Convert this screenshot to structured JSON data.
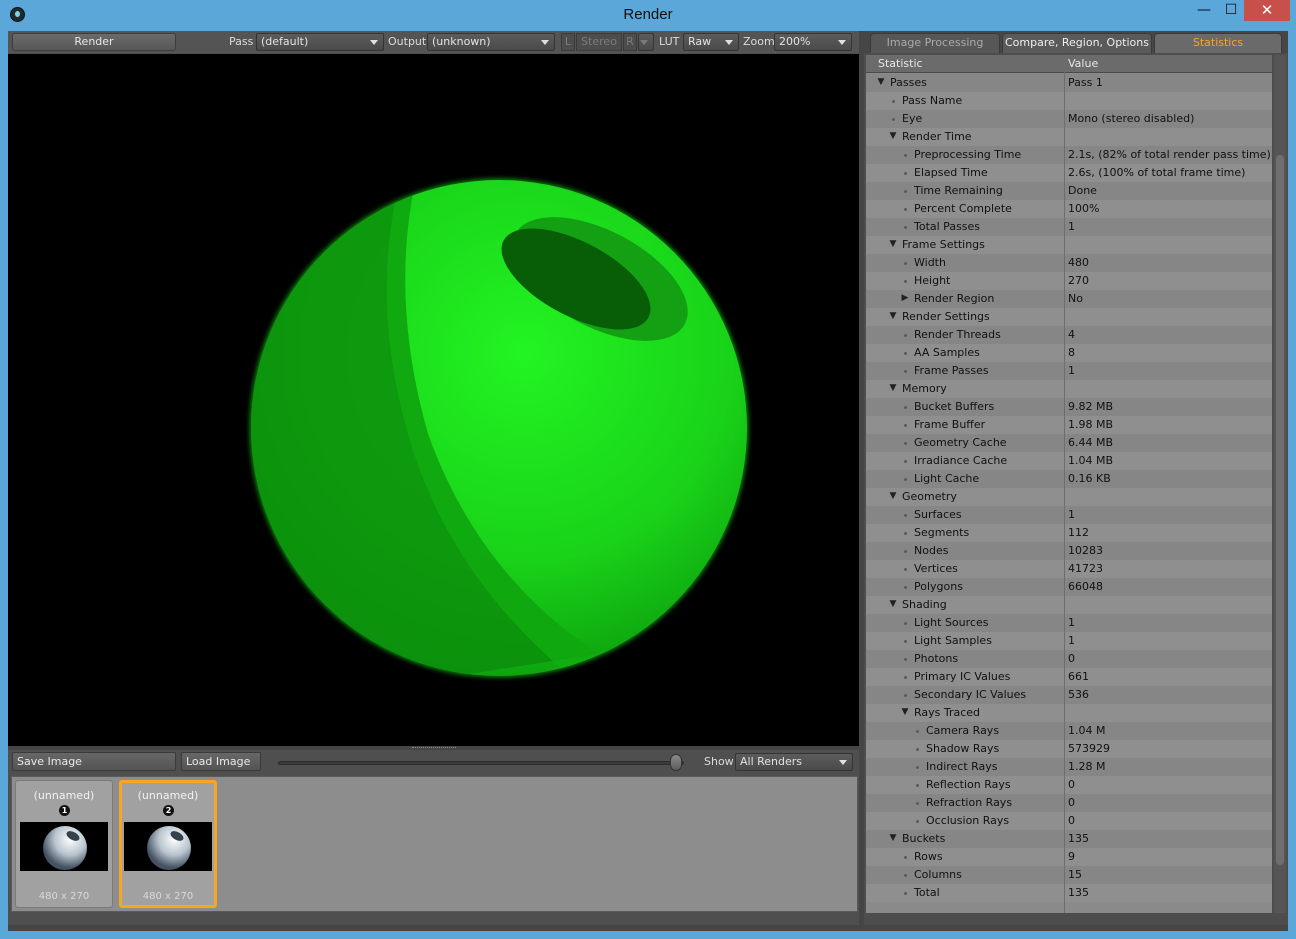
{
  "window": {
    "title": "Render"
  },
  "toolbar": {
    "render_label": "Render",
    "pass_label": "Pass",
    "pass_value": "(default)",
    "output_label": "Output",
    "output_value": "(unknown)",
    "l_label": "L",
    "stereo_label": "Stereo",
    "r_label": "R",
    "lut_label": "LUT",
    "lut_value": "Raw",
    "zoom_label": "Zoom",
    "zoom_value": "200%"
  },
  "bottombar": {
    "save_label": "Save Image",
    "load_label": "Load Image",
    "show_label": "Show",
    "show_value": "All Renders"
  },
  "thumbnails": [
    {
      "name": "(unnamed)",
      "number": "1",
      "size": "480 x 270",
      "selected": false
    },
    {
      "name": "(unnamed)",
      "number": "2",
      "size": "480 x 270",
      "selected": true
    }
  ],
  "tabs": [
    {
      "label": "Image Processing",
      "active": false
    },
    {
      "label": "Compare, Region, Options",
      "active": false
    },
    {
      "label": "Statistics",
      "active": true
    }
  ],
  "stats": {
    "columns": [
      "Statistic",
      "Value"
    ],
    "rows": [
      {
        "name": "Passes",
        "value": "Pass 1",
        "level": 0,
        "expander": "open"
      },
      {
        "name": "Pass Name",
        "value": "",
        "level": 1,
        "expander": "none"
      },
      {
        "name": "Eye",
        "value": "Mono (stereo disabled)",
        "level": 1,
        "expander": "none"
      },
      {
        "name": "Render Time",
        "value": "",
        "level": 1,
        "expander": "open"
      },
      {
        "name": "Preprocessing Time",
        "value": "2.1s, (82% of total render pass time)",
        "level": 2,
        "expander": "none"
      },
      {
        "name": "Elapsed Time",
        "value": "2.6s, (100% of total frame time)",
        "level": 2,
        "expander": "none"
      },
      {
        "name": "Time Remaining",
        "value": "Done",
        "level": 2,
        "expander": "none"
      },
      {
        "name": "Percent Complete",
        "value": "100%",
        "level": 2,
        "expander": "none"
      },
      {
        "name": "Total Passes",
        "value": "1",
        "level": 2,
        "expander": "none"
      },
      {
        "name": "Frame Settings",
        "value": "",
        "level": 1,
        "expander": "open"
      },
      {
        "name": "Width",
        "value": "480",
        "level": 2,
        "expander": "none"
      },
      {
        "name": "Height",
        "value": "270",
        "level": 2,
        "expander": "none"
      },
      {
        "name": "Render Region",
        "value": "No",
        "level": 2,
        "expander": "closed"
      },
      {
        "name": "Render Settings",
        "value": "",
        "level": 1,
        "expander": "open"
      },
      {
        "name": "Render Threads",
        "value": "4",
        "level": 2,
        "expander": "none"
      },
      {
        "name": "AA Samples",
        "value": "8",
        "level": 2,
        "expander": "none"
      },
      {
        "name": "Frame Passes",
        "value": "1",
        "level": 2,
        "expander": "none"
      },
      {
        "name": "Memory",
        "value": "",
        "level": 1,
        "expander": "open"
      },
      {
        "name": "Bucket Buffers",
        "value": "9.82 MB",
        "level": 2,
        "expander": "none"
      },
      {
        "name": "Frame Buffer",
        "value": "1.98 MB",
        "level": 2,
        "expander": "none"
      },
      {
        "name": "Geometry Cache",
        "value": "6.44 MB",
        "level": 2,
        "expander": "none"
      },
      {
        "name": "Irradiance Cache",
        "value": "1.04 MB",
        "level": 2,
        "expander": "none"
      },
      {
        "name": "Light Cache",
        "value": "0.16 KB",
        "level": 2,
        "expander": "none"
      },
      {
        "name": "Geometry",
        "value": "",
        "level": 1,
        "expander": "open"
      },
      {
        "name": "Surfaces",
        "value": "1",
        "level": 2,
        "expander": "none"
      },
      {
        "name": "Segments",
        "value": "112",
        "level": 2,
        "expander": "none"
      },
      {
        "name": "Nodes",
        "value": "10283",
        "level": 2,
        "expander": "none"
      },
      {
        "name": "Vertices",
        "value": "41723",
        "level": 2,
        "expander": "none"
      },
      {
        "name": "Polygons",
        "value": "66048",
        "level": 2,
        "expander": "none"
      },
      {
        "name": "Shading",
        "value": "",
        "level": 1,
        "expander": "open"
      },
      {
        "name": "Light Sources",
        "value": "1",
        "level": 2,
        "expander": "none"
      },
      {
        "name": "Light Samples",
        "value": "1",
        "level": 2,
        "expander": "none"
      },
      {
        "name": "Photons",
        "value": "0",
        "level": 2,
        "expander": "none"
      },
      {
        "name": "Primary IC Values",
        "value": "661",
        "level": 2,
        "expander": "none"
      },
      {
        "name": "Secondary IC Values",
        "value": "536",
        "level": 2,
        "expander": "none"
      },
      {
        "name": "Rays Traced",
        "value": "",
        "level": 2,
        "expander": "open"
      },
      {
        "name": "Camera Rays",
        "value": "1.04 M",
        "level": 3,
        "expander": "none"
      },
      {
        "name": "Shadow Rays",
        "value": "573929",
        "level": 3,
        "expander": "none"
      },
      {
        "name": "Indirect Rays",
        "value": "1.28 M",
        "level": 3,
        "expander": "none"
      },
      {
        "name": "Reflection Rays",
        "value": "0",
        "level": 3,
        "expander": "none"
      },
      {
        "name": "Refraction Rays",
        "value": "0",
        "level": 3,
        "expander": "none"
      },
      {
        "name": "Occlusion Rays",
        "value": "0",
        "level": 3,
        "expander": "none"
      },
      {
        "name": "Buckets",
        "value": "135",
        "level": 1,
        "expander": "open"
      },
      {
        "name": "Rows",
        "value": "9",
        "level": 2,
        "expander": "none"
      },
      {
        "name": "Columns",
        "value": "15",
        "level": 2,
        "expander": "none"
      },
      {
        "name": "Total",
        "value": "135",
        "level": 2,
        "expander": "none"
      }
    ]
  },
  "colors": {
    "accent": "#f5a623",
    "sphere": "#1fe81f",
    "window_frame": "#5ba7d9",
    "close_button": "#c7504a"
  },
  "icons": {
    "app": "modo-logo-icon",
    "minimize": "minimize-icon",
    "maximize": "maximize-icon",
    "close": "close-icon"
  }
}
